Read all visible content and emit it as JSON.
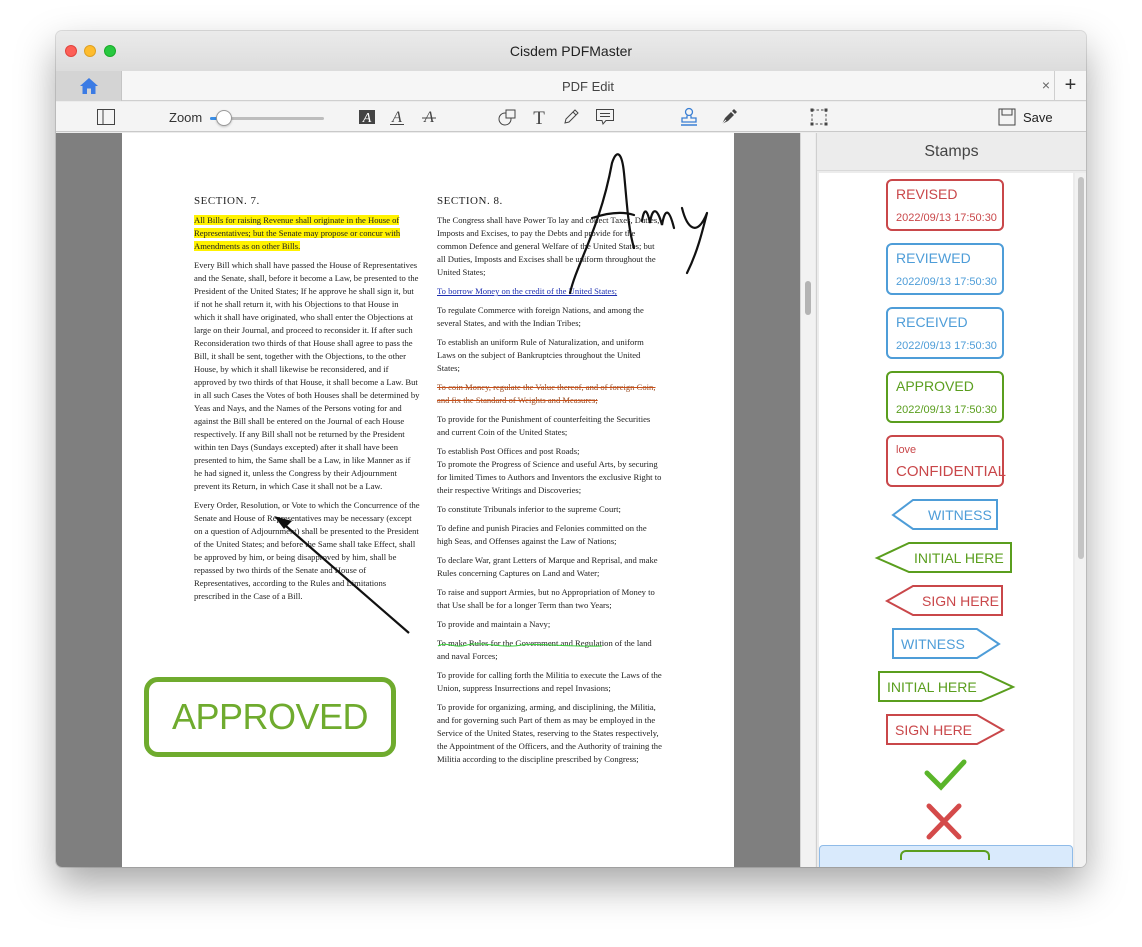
{
  "window": {
    "title": "Cisdem PDFMaster"
  },
  "tabs": {
    "active_label": "PDF Edit",
    "close": "×",
    "add": "+"
  },
  "toolbar": {
    "zoom_label": "Zoom",
    "zoom_level": 0.12,
    "save_label": "Save"
  },
  "document": {
    "section7_heading": "SECTION. 7.",
    "section7_p1": "All Bills for raising Revenue shall originate in the House of Representatives; but the Senate may propose or concur with Amendments as on other Bills.",
    "section7_p2": "Every Bill which shall have passed the House of Representatives and the Senate, shall, before it become a Law, be presented to the President of the United States; If he approve he shall sign it, but if not he shall return it, with his Objections to that House in which it shall have originated, who shall enter the Objections at large on their Journal, and proceed to reconsider it. If after such Reconsideration two thirds of that House shall agree to pass the Bill, it shall be sent, together with the Objections, to the other House, by which it shall likewise be reconsidered, and if approved by two thirds of that House, it shall become a Law. But in all such Cases the Votes of both Houses shall be determined by Yeas and Nays, and the Names of the Persons voting for and against the Bill shall be entered on the Journal of each House respectively. If any Bill shall not be returned by the President within ten Days (Sundays excepted) after it shall have been presented to him, the Same shall be a Law, in like Manner as if he had signed it, unless the Congress by their Adjournment prevent its Return, in which Case it shall not be a Law.",
    "section7_p3": "Every Order, Resolution, or Vote to which the Concurrence of the Senate and House of Representatives may be necessary (except on a question of Adjournment) shall be presented to the President of the United States; and before the Same shall take Effect, shall be approved by him, or being disapproved by him, shall be repassed by two thirds of the Senate and House of Representatives, according to the Rules and Limitations prescribed in the Case of a Bill.",
    "section8_heading": "SECTION. 8.",
    "section8_p1": "The Congress shall have Power To lay and collect Taxes, Duties, Imposts and Excises, to pay the Debts and provide for the common Defence and general Welfare of the United States; but all Duties, Imposts and Excises shall be uniform throughout the United States;",
    "section8_p2": "To borrow Money on the credit of the United States;",
    "section8_p3": "To regulate Commerce with foreign Nations, and among the several States, and with the Indian Tribes;",
    "section8_p4": "To establish an uniform Rule of Naturalization, and uniform Laws on the subject of Bankruptcies throughout the United States;",
    "section8_p5": "To coin Money, regulate the Value thereof, and of foreign Coin, and fix the Standard of Weights and Measures;",
    "section8_p6": "To provide for the Punishment of counterfeiting the Securities and current Coin of the United States;",
    "section8_p7": "To establish Post Offices and post Roads;",
    "section8_p8": "To promote the Progress of Science and useful Arts, by securing for limited Times to Authors and Inventors the exclusive Right to their respective Writings and Discoveries;",
    "section8_p9": "To constitute Tribunals inferior to the supreme Court;",
    "section8_p10": "To define and punish Piracies and Felonies committed on the high Seas, and Offenses against the Law of Nations;",
    "section8_p11": "To declare War, grant Letters of Marque and Reprisal, and make Rules concerning Captures on Land and Water;",
    "section8_p12": "To raise and support Armies, but no Appropriation of Money to that Use shall be for a longer Term than two Years;",
    "section8_p13": "To provide and maintain a Navy;",
    "section8_p14": "To make Rules for the Government and Regulation of the land and naval Forces;",
    "section8_p15": "To provide for calling forth the Militia to execute the Laws of the Union, suppress Insurrections and repel Invasions;",
    "section8_p16": "To provide for organizing, arming, and disciplining, the Militia, and for governing such Part of them as may be employed in the Service of the United States, reserving to the States respectively, the Appointment of the Officers, and the Authority of training the Militia according to the discipline prescribed by Congress;",
    "placed_stamp": "APPROVED"
  },
  "sidebar": {
    "title": "Stamps",
    "stamps": [
      {
        "label": "REVISED",
        "date": "2022/09/13 17:50:30",
        "color": "#c9474a"
      },
      {
        "label": "REVIEWED",
        "date": "2022/09/13 17:50:30",
        "color": "#4e9dd8"
      },
      {
        "label": "RECEIVED",
        "date": "2022/09/13 17:50:30",
        "color": "#4e9dd8"
      },
      {
        "label": "APPROVED",
        "date": "2022/09/13 17:50:30",
        "color": "#5a9e1e"
      },
      {
        "label": "CONFIDENTIAL",
        "date": "love",
        "color": "#c9474a"
      }
    ],
    "arrow_stamps": [
      {
        "label": "WITNESS",
        "dir": "left",
        "color": "#4e9dd8"
      },
      {
        "label": "INITIAL HERE",
        "dir": "left",
        "color": "#5a9e1e"
      },
      {
        "label": "SIGN HERE",
        "dir": "left",
        "color": "#c9474a"
      },
      {
        "label": "WITNESS",
        "dir": "right",
        "color": "#4e9dd8"
      },
      {
        "label": "INITIAL HERE",
        "dir": "right",
        "color": "#5a9e1e"
      },
      {
        "label": "SIGN HERE",
        "dir": "right",
        "color": "#c9474a"
      }
    ]
  }
}
